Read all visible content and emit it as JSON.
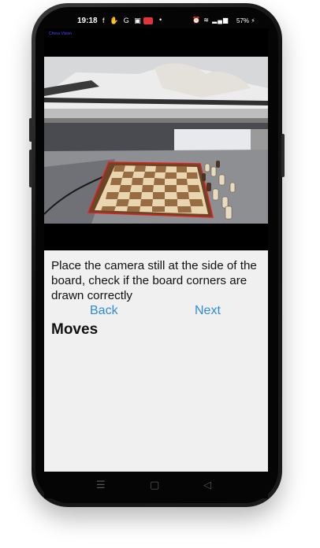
{
  "status_bar": {
    "time": "19:18",
    "left_icons": [
      "facebook-icon",
      "hand-icon",
      "google-icon",
      "teams-icon"
    ],
    "rec_badge": "",
    "right_icons": [
      "alarm-icon",
      "wifi-icon",
      "signal-icon",
      "signal-icon"
    ],
    "battery": "57%"
  },
  "app": {
    "tiny_label": "Chess Vision",
    "instruction": "Place the camera still at the side of the board, check if the board corners are drawn correctly",
    "back_label": "Back",
    "next_label": "Next",
    "moves_heading": "Moves"
  },
  "nav_bar": {
    "menu_icon": "☰",
    "home_icon": "▢",
    "back_icon": "◁"
  },
  "colors": {
    "link": "#2e8bdb",
    "corner_outline": "#e02020",
    "screen_bg": "#f0f0f0"
  }
}
